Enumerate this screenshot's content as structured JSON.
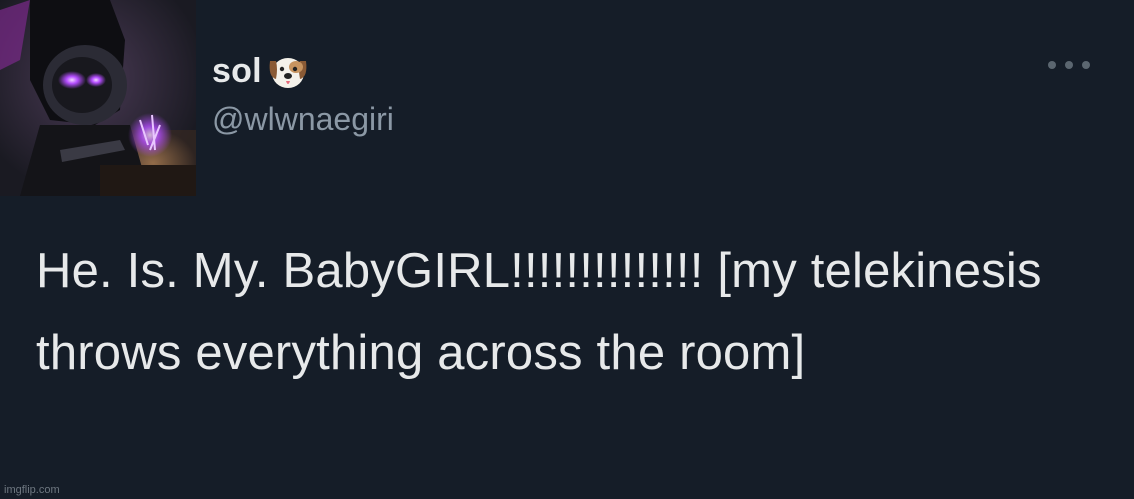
{
  "tweet": {
    "display_name": "sol",
    "name_emoji": "dog-face-icon",
    "handle": "@wlwnaegiri",
    "text": "He. Is. My. BabyGIRL!!!!!!!!!!!!!! [my telekinesis throws everything across the room]"
  },
  "more_icon": "more-options-icon",
  "watermark": "imgflip.com",
  "colors": {
    "background": "#151d28",
    "text": "#e7e9ea",
    "secondary": "#8b98a5",
    "accent_glow": "#b44dff"
  }
}
